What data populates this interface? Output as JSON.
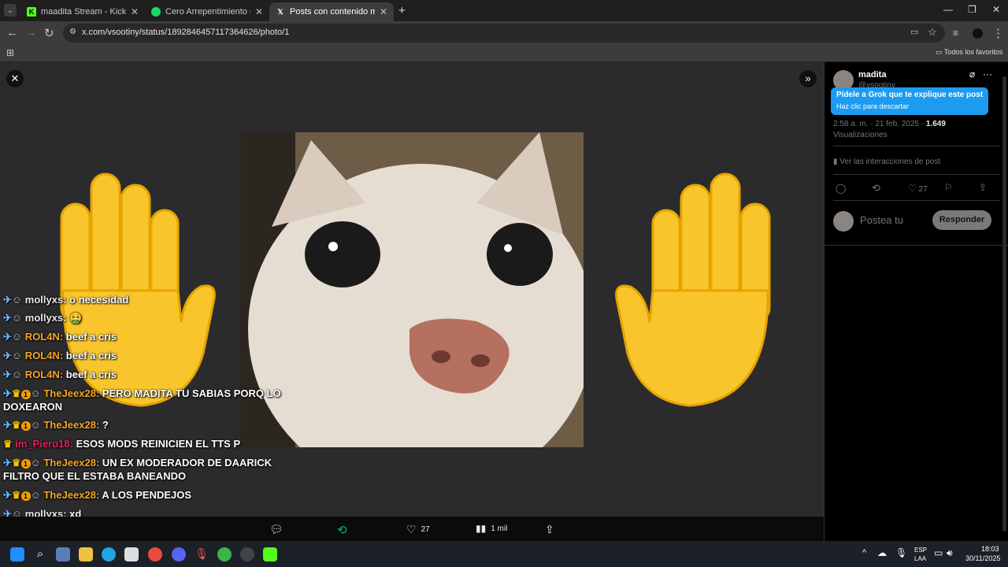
{
  "browser": {
    "tabs": [
      {
        "title": "maadita Stream - Kick Dashboa",
        "favicon": "kick-icon",
        "active": false
      },
      {
        "title": "Cero Arrepentimiento • TheDa",
        "favicon": "spotify-icon",
        "active": false
      },
      {
        "title": "Posts con contenido multimed",
        "favicon": "x-icon",
        "active": true
      }
    ],
    "url": "x.com/vsootiny/status/1892846457117364626/photo/1",
    "bookmarks_label": "Todos los favoritos"
  },
  "chat": [
    {
      "badges": [
        "sword",
        "bear"
      ],
      "user": "mollyxs",
      "user_color": "#e7e9ea",
      "message": "o necesidad"
    },
    {
      "badges": [
        "sword",
        "bear"
      ],
      "user": "mollyxs",
      "user_color": "#e7e9ea",
      "message": "🤮"
    },
    {
      "badges": [
        "sword",
        "bear"
      ],
      "user": "ROL4N",
      "user_color": "#f5a623",
      "message": "beef a cris"
    },
    {
      "badges": [
        "sword",
        "bear"
      ],
      "user": "ROL4N",
      "user_color": "#f5a623",
      "message": "beef a cris"
    },
    {
      "badges": [
        "sword",
        "bear"
      ],
      "user": "ROL4N",
      "user_color": "#f5a623",
      "message": "beef a cris"
    },
    {
      "badges": [
        "sword",
        "crown",
        "one",
        "bear"
      ],
      "user": "TheJeex28",
      "user_color": "#f5a623",
      "message": "PERO MADITA TU SABIAS PORQ LO",
      "continuation": "DOXEARON"
    },
    {
      "badges": [
        "sword",
        "crown",
        "one",
        "bear"
      ],
      "user": "TheJeex28",
      "user_color": "#f5a623",
      "message": "?"
    },
    {
      "badges": [
        "crown"
      ],
      "user": "im_Piero18",
      "user_color": "#e0245e",
      "message": "ESOS MODS REINICIEN EL TTS P"
    },
    {
      "badges": [
        "sword",
        "crown",
        "one",
        "bear"
      ],
      "user": "TheJeex28",
      "user_color": "#f5a623",
      "message": "UN EX MODERADOR DE DAARICK",
      "continuation": "FILTRO QUE EL ESTABA BANEANDO"
    },
    {
      "badges": [
        "sword",
        "crown",
        "one",
        "bear"
      ],
      "user": "TheJeex28",
      "user_color": "#f5a623",
      "message": "A LOS PENDEJOS"
    },
    {
      "badges": [
        "sword",
        "bear"
      ],
      "user": "mollyxs",
      "user_color": "#e7e9ea",
      "message": "xd"
    }
  ],
  "media_actions": {
    "likes": "27",
    "views": "1 mil"
  },
  "post": {
    "display_name": "madita",
    "handle": "@vsootiny",
    "tooltip_title": "Pídele a Grok que te explique este post",
    "tooltip_sub": "Haz clic para descartar",
    "timestamp": "2:58 a. m. · 21 feb. 2025 · ",
    "views_count": "1.649",
    "views_label": "Visualizaciones",
    "interactions_link": "Ver las interacciones de post",
    "likes": "27",
    "reply_placeholder": "Postea tu",
    "reply_button": "Responder"
  },
  "taskbar": {
    "lang_top": "ESP",
    "lang_bottom": "LAA",
    "time": "18:03",
    "date": "30/11/2025"
  },
  "colors": {
    "accent": "#1d9bf0",
    "emoji_hand": "#f8c62c"
  }
}
